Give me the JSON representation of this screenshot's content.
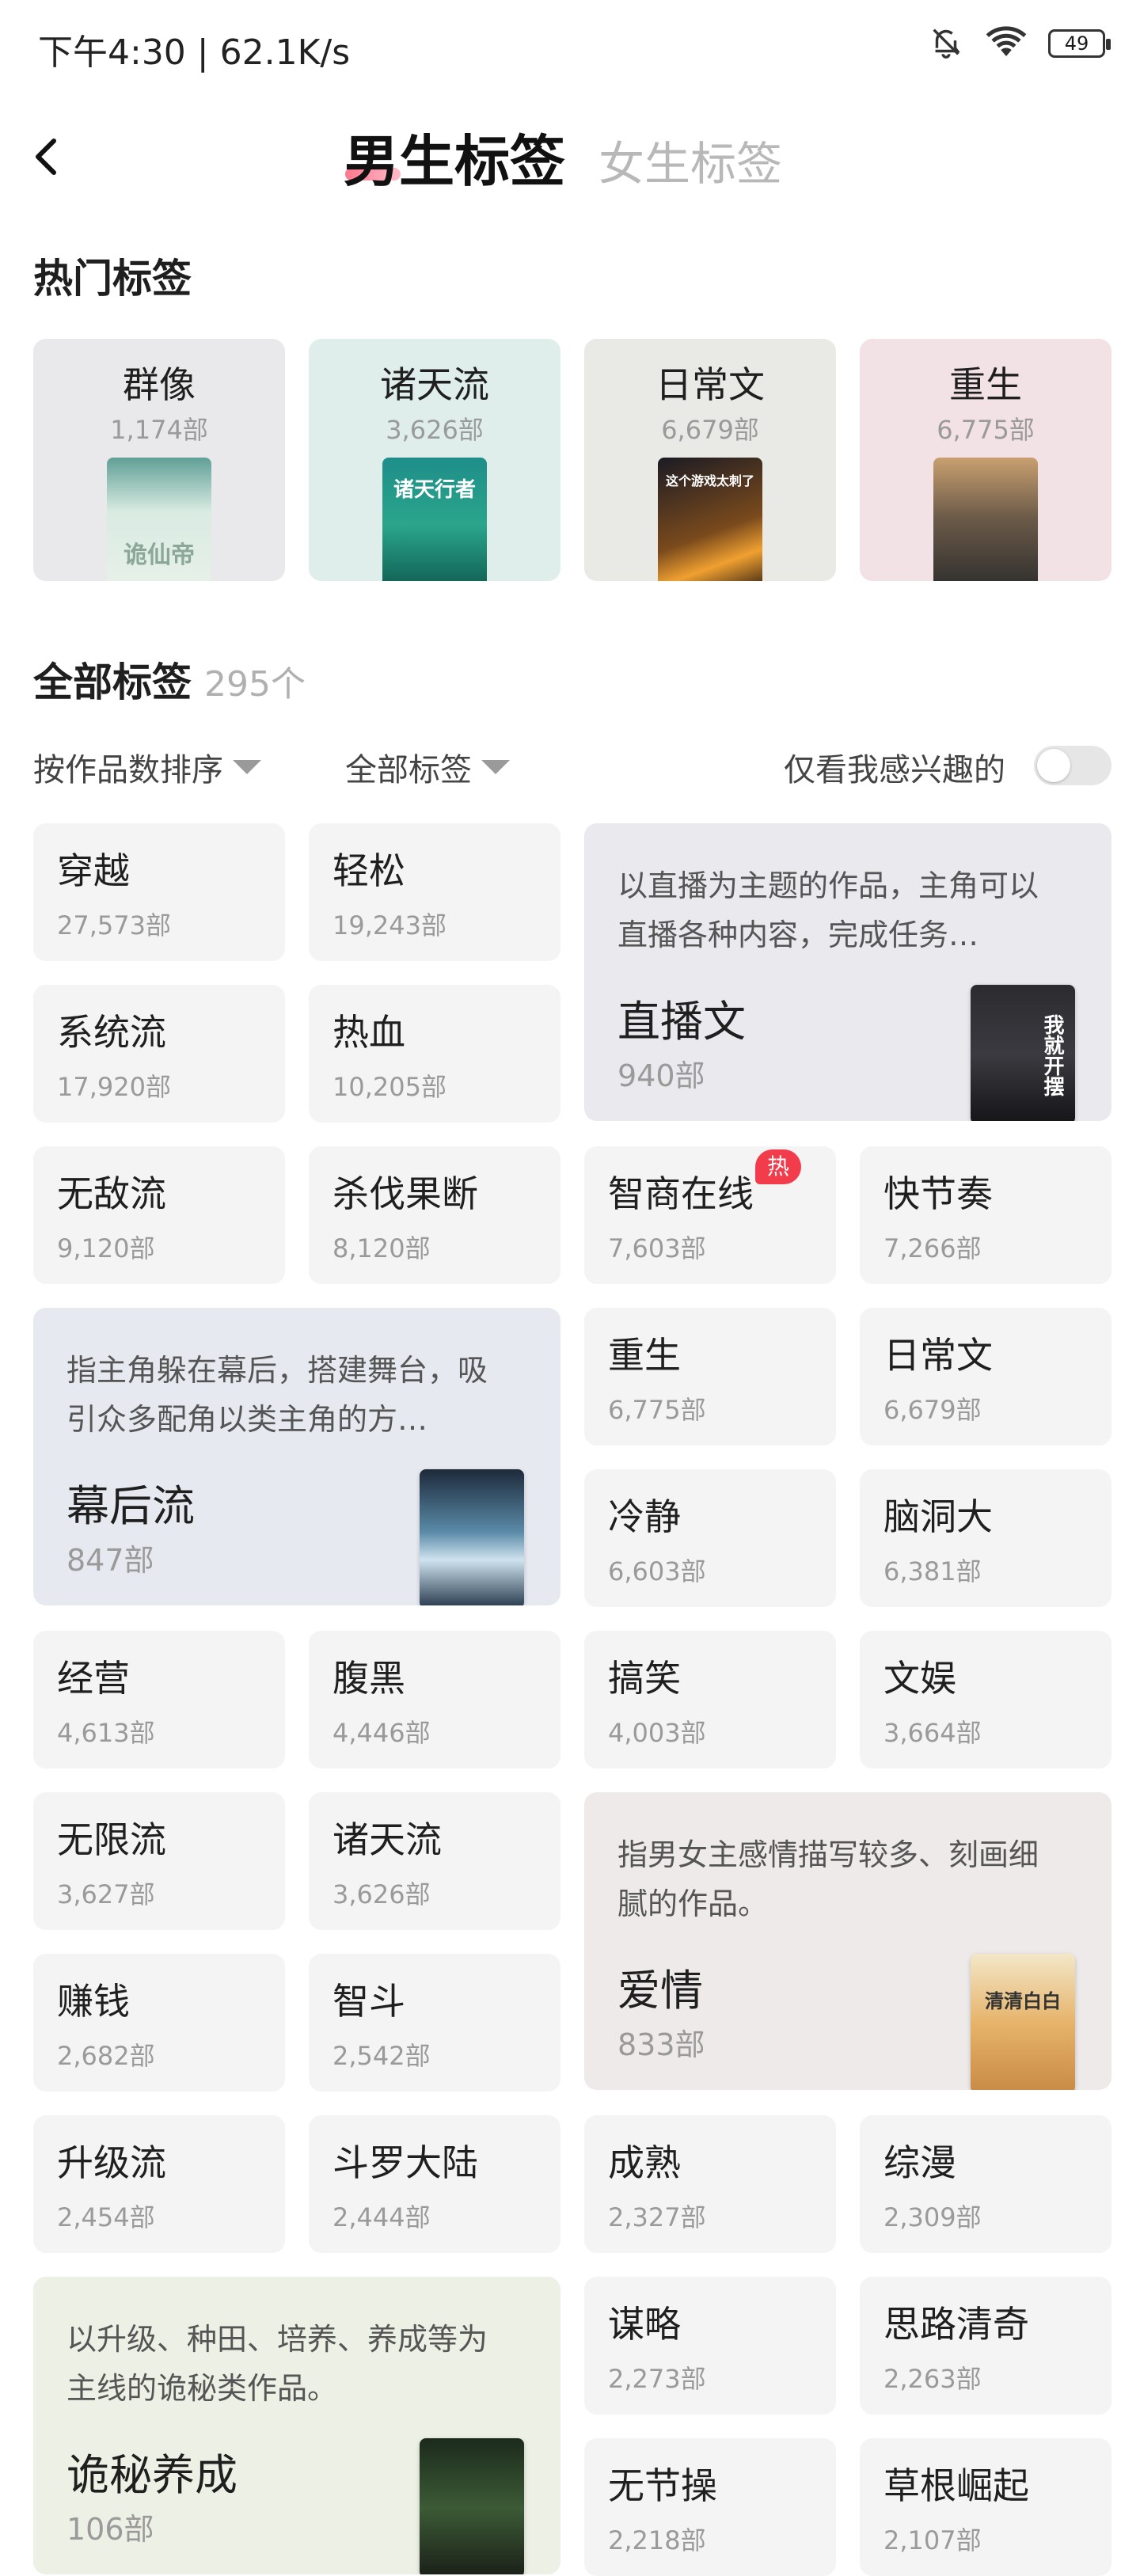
{
  "status": {
    "time": "下午4:30 | 62.1K/s",
    "battery": "49"
  },
  "header": {
    "active_tab": "男生标签",
    "inactive_tab": "女生标签"
  },
  "hot": {
    "title": "热门标签",
    "items": [
      {
        "name": "群像",
        "count": "1,174部",
        "cover_text": "诡仙帝",
        "bg": "#e9e8ea"
      },
      {
        "name": "诸天流",
        "count": "3,626部",
        "cover_text": "诸天行者",
        "bg": "#dfeeeb"
      },
      {
        "name": "日常文",
        "count": "6,679部",
        "cover_text": "这个游戏太刺了",
        "bg": "#e9eae5"
      },
      {
        "name": "重生",
        "count": "6,775部",
        "cover_text": "",
        "bg": "#f2e1e5"
      }
    ]
  },
  "all": {
    "title": "全部标签",
    "count": "295个"
  },
  "filters": {
    "sort": "按作品数排序",
    "scope": "全部标签",
    "interest_label": "仅看我感兴趣的"
  },
  "hot_badge": "热",
  "tags": [
    {
      "name": "穿越",
      "count": "27,573部"
    },
    {
      "name": "轻松",
      "count": "19,243部"
    },
    {
      "name": "系统流",
      "count": "17,920部"
    },
    {
      "name": "热血",
      "count": "10,205部"
    },
    {
      "name": "无敌流",
      "count": "9,120部"
    },
    {
      "name": "杀伐果断",
      "count": "8,120部"
    },
    {
      "name": "智商在线",
      "count": "7,603部"
    },
    {
      "name": "快节奏",
      "count": "7,266部"
    },
    {
      "name": "重生",
      "count": "6,775部"
    },
    {
      "name": "日常文",
      "count": "6,679部"
    },
    {
      "name": "冷静",
      "count": "6,603部"
    },
    {
      "name": "脑洞大",
      "count": "6,381部"
    },
    {
      "name": "经营",
      "count": "4,613部"
    },
    {
      "name": "腹黑",
      "count": "4,446部"
    },
    {
      "name": "搞笑",
      "count": "4,003部"
    },
    {
      "name": "文娱",
      "count": "3,664部"
    },
    {
      "name": "无限流",
      "count": "3,627部"
    },
    {
      "name": "诸天流",
      "count": "3,626部"
    },
    {
      "name": "赚钱",
      "count": "2,682部"
    },
    {
      "name": "智斗",
      "count": "2,542部"
    },
    {
      "name": "升级流",
      "count": "2,454部"
    },
    {
      "name": "斗罗大陆",
      "count": "2,444部"
    },
    {
      "name": "成熟",
      "count": "2,327部"
    },
    {
      "name": "综漫",
      "count": "2,309部"
    },
    {
      "name": "谋略",
      "count": "2,273部"
    },
    {
      "name": "思路清奇",
      "count": "2,263部"
    },
    {
      "name": "无节操",
      "count": "2,218部"
    },
    {
      "name": "草根崛起",
      "count": "2,107部"
    }
  ],
  "features": [
    {
      "desc": "以直播为主题的作品，主角可以直播各种内容，完成任务…",
      "name": "直播文",
      "count": "940部",
      "cover_text": "我就开摆",
      "bg": "#e9e9ee"
    },
    {
      "desc": "指主角躲在幕后，搭建舞台，吸引众多配角以类主角的方…",
      "name": "幕后流",
      "count": "847部",
      "cover_text": "",
      "bg": "#e6eaf0"
    },
    {
      "desc": "指男女主感情描写较多、刻画细腻的作品。",
      "name": "爱情",
      "count": "833部",
      "cover_text": "清清白白",
      "bg": "#edeae9"
    },
    {
      "desc": "以升级、种田、培养、养成等为主线的诡秘类作品。",
      "name": "诡秘养成",
      "count": "106部",
      "cover_text": "",
      "bg": "#edf0e4"
    }
  ]
}
